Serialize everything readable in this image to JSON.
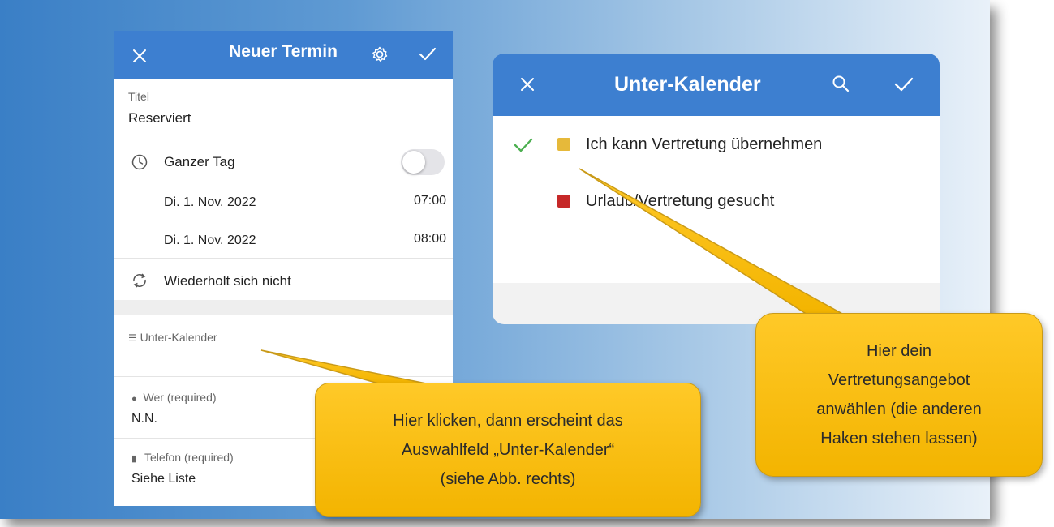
{
  "colors": {
    "accent": "#3d7fd0",
    "callout": "#ffc000",
    "check": "#4caf50",
    "yellow_square": "#e6b93a",
    "red_square": "#c62828"
  },
  "event_form": {
    "title": "Neuer Termin",
    "icons": [
      "close-icon",
      "gear-icon",
      "check-icon"
    ],
    "titel_label": "Titel",
    "titel_value": "Reserviert",
    "ganzer_tag_label": "Ganzer Tag",
    "start_date": "Di. 1. Nov. 2022",
    "start_time": "07:00",
    "end_date": "Di. 1. Nov. 2022",
    "end_time": "08:00",
    "repeat_label": "Wiederholt sich nicht",
    "unterkalender_label": "Unter-Kalender",
    "wer_label": "Wer (required)",
    "wer_value": "N.N.",
    "telefon_label": "Telefon (required)",
    "telefon_value": "Siehe Liste"
  },
  "calendar_panel": {
    "title": "Unter-Kalender",
    "icons": [
      "close-icon",
      "search-icon",
      "check-icon"
    ],
    "items": [
      {
        "label": "Ich kann Vertretung übernehmen",
        "checked": true
      },
      {
        "label": "Urlaub/Vertretung gesucht",
        "checked": false
      }
    ]
  },
  "callouts": {
    "left": [
      "Hier klicken, dann erscheint das",
      "Auswahlfeld „Unter-Kalender“",
      "(siehe Abb. rechts)"
    ],
    "right": [
      "Hier dein",
      "Vertretungsangebot",
      "anwählen (die anderen",
      "Haken stehen lassen)"
    ]
  }
}
